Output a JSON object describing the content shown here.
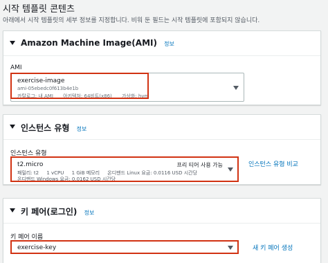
{
  "page": {
    "title": "시작 템플릿 콘텐츠",
    "description": "아래에서 시작 템플릿의 세부 정보를 지정합니다. 비워 둔 필드는 시작 템플릿에 포함되지 않습니다."
  },
  "ami_panel": {
    "title": "Amazon Machine Image(AMI)",
    "info": "정보",
    "field_label": "AMI",
    "selected": {
      "name": "exercise-image",
      "id": "ami-05ebedc0f613b4e1b",
      "catalog": "카탈로그: 내 AMI",
      "architecture": "아키텍처: 64비트(x86)",
      "virtualization": "가상화: hvm"
    }
  },
  "instance_panel": {
    "title": "인스턴스 유형",
    "info": "정보",
    "field_label": "인스턴스 유형",
    "selected": {
      "name": "t2.micro",
      "free_tier": "프리 티어 사용 가능",
      "line1": [
        "패밀리: t2",
        "1 vCPU",
        "1 GiB 메모리",
        "온디맨드 Linux 요금: 0.0116 USD 시간당"
      ],
      "line2": "온디맨드 Windows 요금: 0.0162 USD 시간당"
    },
    "compare_link": "인스턴스 유형 비교"
  },
  "keypair_panel": {
    "title": "키 페어(로그인)",
    "info": "정보",
    "field_label": "키 페어 이름",
    "selected": "exercise-key",
    "new_link": "새 키 페어 생성"
  },
  "colors": {
    "highlight": "#d13212",
    "link": "#0073bb"
  }
}
